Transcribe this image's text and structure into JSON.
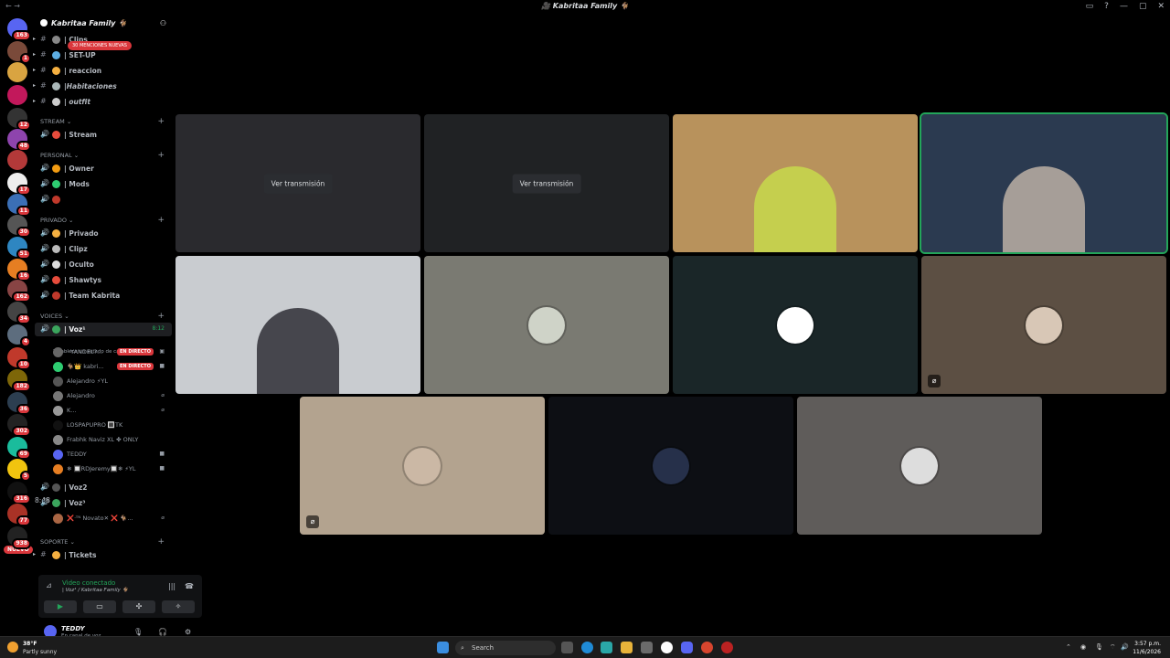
{
  "window": {
    "title": "🎥 Kabritaa Family 🐐",
    "nav": "← →",
    "controls": [
      "▭",
      "?",
      "—",
      "▢",
      "✕"
    ]
  },
  "rail": {
    "nuevo": "NUEVO",
    "servers": [
      {
        "badge": "163",
        "color": "#5865f2"
      },
      {
        "badge": "1",
        "color": "#7a4a3a"
      },
      {
        "badge": "",
        "color": "#d9a441"
      },
      {
        "badge": "",
        "color": "#c2185b"
      },
      {
        "badge": "12",
        "color": "#333333"
      },
      {
        "badge": "48",
        "color": "#8e44ad"
      },
      {
        "badge": "",
        "color": "#b33939"
      },
      {
        "badge": "17",
        "color": "#eeeeee"
      },
      {
        "badge": "11",
        "color": "#3b6fb6"
      },
      {
        "badge": "30",
        "color": "#555555"
      },
      {
        "badge": "51",
        "color": "#2e86c1"
      },
      {
        "badge": "16",
        "color": "#e67e22"
      },
      {
        "badge": "162",
        "color": "#884444"
      },
      {
        "badge": "34",
        "color": "#444444"
      },
      {
        "badge": "4",
        "color": "#5d6d7e"
      },
      {
        "badge": "10",
        "color": "#c0392b"
      },
      {
        "badge": "182",
        "color": "#7d6608"
      },
      {
        "badge": "36",
        "color": "#2c3e50"
      },
      {
        "badge": "302",
        "color": "#222222"
      },
      {
        "badge": "69",
        "color": "#1abc9c"
      },
      {
        "badge": "5",
        "color": "#f1c40f"
      },
      {
        "badge": "316",
        "color": "#111111"
      },
      {
        "badge": "77",
        "color": "#a93226"
      },
      {
        "badge": "938",
        "color": "#222222"
      }
    ]
  },
  "sidebar": {
    "guild_name": "Kabritaa Family 🐐",
    "mentions": "30 MENCIONES NUEVAS",
    "channels_top": [
      {
        "name": "| Clips",
        "italic": false,
        "color": "#888888"
      },
      {
        "name": "| SET-UP",
        "italic": false,
        "color": "#5dade2"
      },
      {
        "name": "| reaccion",
        "italic": false,
        "color": "#f5b041"
      },
      {
        "name": "|Habitaciones",
        "italic": true,
        "color": "#aab7b8"
      },
      {
        "name": "| outfit",
        "italic": true,
        "color": "#cccccc"
      }
    ],
    "cat_stream": "STREAM",
    "stream_channels": [
      {
        "name": "| Stream",
        "color": "#e74c3c"
      }
    ],
    "cat_personal": "PERSONAL",
    "personal_channels": [
      {
        "name": "| Owner",
        "color": "#f39c12"
      },
      {
        "name": "| Mods",
        "color": "#2ecc71"
      },
      {
        "name": "",
        "color": "#c0392b"
      }
    ],
    "cat_privado": "PRIVADO",
    "privado_channels": [
      {
        "name": "| Privado",
        "color": "#f5b041"
      },
      {
        "name": "| Clipz",
        "color": "#bbbbbb"
      },
      {
        "name": "| Oculto",
        "color": "#dddddd"
      },
      {
        "name": "| Shawtys",
        "color": "#e74c3c"
      },
      {
        "name": "| Team Kabrita",
        "color": "#c0392b"
      }
    ],
    "cat_voices": "VOICES",
    "voz1": {
      "name": "| Voz¹",
      "time": "8:12"
    },
    "voz_status": "Establece un estado de canal ✏",
    "live_label": "EN DIRECTO",
    "voz1_users": [
      {
        "name": "· YANDEL?...",
        "color": "#666666",
        "live": true,
        "right": "▣"
      },
      {
        "name": "🐐👑 kabri...",
        "color": "#2ecc71",
        "live": true,
        "right": "■"
      },
      {
        "name": "Alejandro ⚡YL",
        "color": "#555555",
        "live": false,
        "right": ""
      },
      {
        "name": "Alejandro",
        "color": "#777777",
        "live": false,
        "right": "⌀"
      },
      {
        "name": "K...",
        "color": "#999999",
        "live": false,
        "right": "⌀"
      },
      {
        "name": "LOSPAPUPRO 🔳TK",
        "color": "#111111",
        "live": false,
        "right": ""
      },
      {
        "name": "Frabhk Naviz XL ✤ ONLY",
        "color": "#888888",
        "live": false,
        "right": ""
      },
      {
        "name": "TEDDY",
        "color": "#5865f2",
        "live": false,
        "right": "■"
      },
      {
        "name": "❄ 🔲RDJeremy🔲❄ ⚡YL",
        "color": "#e67e22",
        "live": false,
        "right": "■"
      }
    ],
    "voz2": {
      "name": "| Voz2"
    },
    "voz3": {
      "name": "| Voz³",
      "time": "8:48"
    },
    "voz3_users": [
      {
        "name": "❌ᐧᵀᴺ Novato✕ ❌ 🐐...",
        "color": "#aa6644",
        "right": "⌀"
      }
    ],
    "cat_soporte": "SOPORTE",
    "soporte_channels": [
      {
        "name": "| Tickets",
        "color": "#f5b041"
      }
    ]
  },
  "voice_panel": {
    "connected": "Video conectado",
    "channel": "| Voz¹ / Kabritaa Family 🐐",
    "buttons": [
      "▶",
      "▭",
      "✣",
      "✧"
    ]
  },
  "user_panel": {
    "username": "TEDDY",
    "status": "En canal de voz"
  },
  "stage": {
    "stream_button": "Ver transmisión",
    "tiles": [
      {
        "kind": "stream",
        "bg": "#2a2a2e"
      },
      {
        "kind": "stream",
        "bg": "#202224"
      },
      {
        "kind": "camera",
        "bg": "#b8925c",
        "accent": "#c9e34a"
      },
      {
        "kind": "camera",
        "bg": "#2b3a50",
        "accent": "#d0c0b0",
        "speaking": true
      },
      {
        "kind": "camera",
        "bg": "#c9ccd0",
        "accent": "#1a1a22"
      },
      {
        "kind": "avatar",
        "bg": "#7a7a72",
        "avatar": "#cfd3c8"
      },
      {
        "kind": "avatar",
        "bg": "#1a2628",
        "avatar": "#ffffff"
      },
      {
        "kind": "avatar",
        "bg": "#5c4f43",
        "avatar": "#d8c7b6",
        "muted": true
      },
      {
        "kind": "avatar",
        "bg": "#b3a38f",
        "avatar": "#cbb8a5",
        "muted": true
      },
      {
        "kind": "avatar",
        "bg": "#0d0f14",
        "avatar": "#26304a"
      },
      {
        "kind": "avatar",
        "bg": "#5f5c5a",
        "avatar": "#dddddd"
      }
    ]
  },
  "taskbar": {
    "temp": "38°F",
    "condition": "Partly sunny",
    "search": "Search",
    "time": "3:57 p.m.",
    "date": "11/6/2026"
  }
}
